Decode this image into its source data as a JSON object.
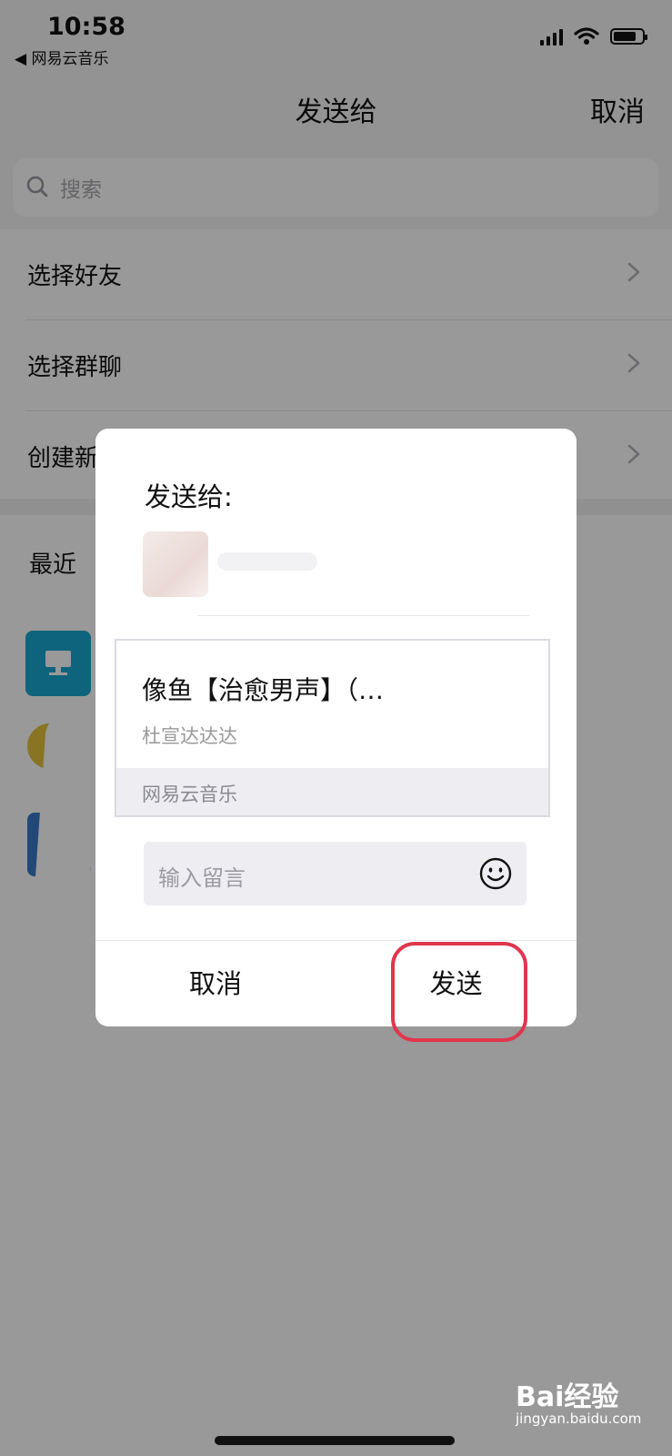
{
  "status_bar": {
    "time": "10:58",
    "back_app": "◀ 网易云音乐",
    "battery_level": 0.8
  },
  "nav": {
    "title": "发送给",
    "cancel": "取消"
  },
  "search": {
    "placeholder": "搜索"
  },
  "menu": [
    {
      "label": "选择好友"
    },
    {
      "label": "选择群聊"
    },
    {
      "label": "创建新"
    }
  ],
  "recent": {
    "label": "最近"
  },
  "dialog": {
    "title": "发送给:",
    "card": {
      "title": "像鱼【治愈男声】（…",
      "subtitle": "杜宣达达达",
      "source": "网易云音乐"
    },
    "message_placeholder": "输入留言",
    "cancel": "取消",
    "send": "发送"
  },
  "watermark": {
    "main": "Bai经验",
    "sub": "jingyan.baidu.com"
  }
}
